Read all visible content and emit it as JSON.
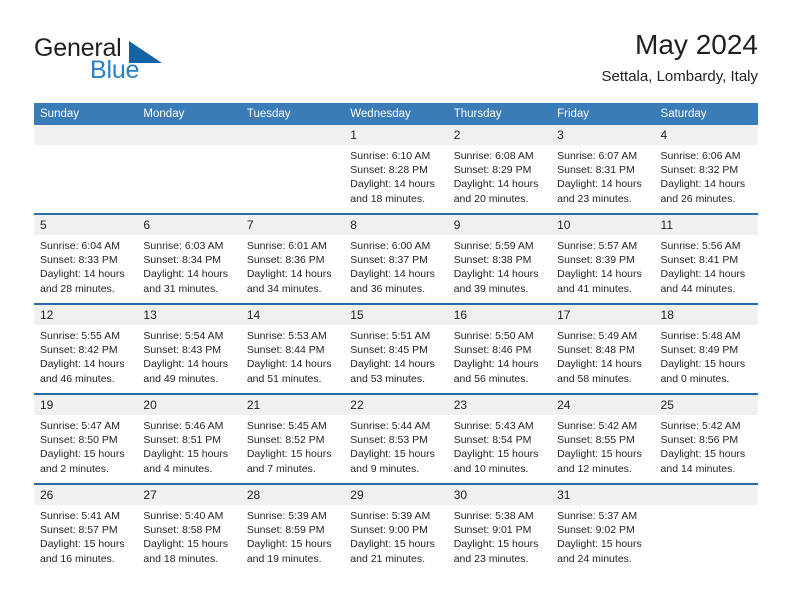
{
  "logo": {
    "word1": "General",
    "word2": "Blue",
    "triangle_color": "#1362a4",
    "blue_text_color": "#2980c4"
  },
  "header": {
    "title": "May 2024",
    "subtitle": "Settala, Lombardy, Italy"
  },
  "theme": {
    "header_blue": "#3a7cb8",
    "row_rule_blue": "#2b6ca8",
    "daynum_band": "#f0f0f0",
    "text": "#231f20"
  },
  "weekday_headers": [
    "Sunday",
    "Monday",
    "Tuesday",
    "Wednesday",
    "Thursday",
    "Friday",
    "Saturday"
  ],
  "labels": {
    "sunrise_prefix": "Sunrise:",
    "sunset_prefix": "Sunset:",
    "daylight_prefix": "Daylight:"
  },
  "weeks": [
    [
      {
        "day": "",
        "empty": true
      },
      {
        "day": "",
        "empty": true
      },
      {
        "day": "",
        "empty": true
      },
      {
        "day": "1",
        "sunrise": "Sunrise: 6:10 AM",
        "sunset": "Sunset: 8:28 PM",
        "daylight1": "Daylight: 14 hours",
        "daylight2": "and 18 minutes."
      },
      {
        "day": "2",
        "sunrise": "Sunrise: 6:08 AM",
        "sunset": "Sunset: 8:29 PM",
        "daylight1": "Daylight: 14 hours",
        "daylight2": "and 20 minutes."
      },
      {
        "day": "3",
        "sunrise": "Sunrise: 6:07 AM",
        "sunset": "Sunset: 8:31 PM",
        "daylight1": "Daylight: 14 hours",
        "daylight2": "and 23 minutes."
      },
      {
        "day": "4",
        "sunrise": "Sunrise: 6:06 AM",
        "sunset": "Sunset: 8:32 PM",
        "daylight1": "Daylight: 14 hours",
        "daylight2": "and 26 minutes."
      }
    ],
    [
      {
        "day": "5",
        "sunrise": "Sunrise: 6:04 AM",
        "sunset": "Sunset: 8:33 PM",
        "daylight1": "Daylight: 14 hours",
        "daylight2": "and 28 minutes."
      },
      {
        "day": "6",
        "sunrise": "Sunrise: 6:03 AM",
        "sunset": "Sunset: 8:34 PM",
        "daylight1": "Daylight: 14 hours",
        "daylight2": "and 31 minutes."
      },
      {
        "day": "7",
        "sunrise": "Sunrise: 6:01 AM",
        "sunset": "Sunset: 8:36 PM",
        "daylight1": "Daylight: 14 hours",
        "daylight2": "and 34 minutes."
      },
      {
        "day": "8",
        "sunrise": "Sunrise: 6:00 AM",
        "sunset": "Sunset: 8:37 PM",
        "daylight1": "Daylight: 14 hours",
        "daylight2": "and 36 minutes."
      },
      {
        "day": "9",
        "sunrise": "Sunrise: 5:59 AM",
        "sunset": "Sunset: 8:38 PM",
        "daylight1": "Daylight: 14 hours",
        "daylight2": "and 39 minutes."
      },
      {
        "day": "10",
        "sunrise": "Sunrise: 5:57 AM",
        "sunset": "Sunset: 8:39 PM",
        "daylight1": "Daylight: 14 hours",
        "daylight2": "and 41 minutes."
      },
      {
        "day": "11",
        "sunrise": "Sunrise: 5:56 AM",
        "sunset": "Sunset: 8:41 PM",
        "daylight1": "Daylight: 14 hours",
        "daylight2": "and 44 minutes."
      }
    ],
    [
      {
        "day": "12",
        "sunrise": "Sunrise: 5:55 AM",
        "sunset": "Sunset: 8:42 PM",
        "daylight1": "Daylight: 14 hours",
        "daylight2": "and 46 minutes."
      },
      {
        "day": "13",
        "sunrise": "Sunrise: 5:54 AM",
        "sunset": "Sunset: 8:43 PM",
        "daylight1": "Daylight: 14 hours",
        "daylight2": "and 49 minutes."
      },
      {
        "day": "14",
        "sunrise": "Sunrise: 5:53 AM",
        "sunset": "Sunset: 8:44 PM",
        "daylight1": "Daylight: 14 hours",
        "daylight2": "and 51 minutes."
      },
      {
        "day": "15",
        "sunrise": "Sunrise: 5:51 AM",
        "sunset": "Sunset: 8:45 PM",
        "daylight1": "Daylight: 14 hours",
        "daylight2": "and 53 minutes."
      },
      {
        "day": "16",
        "sunrise": "Sunrise: 5:50 AM",
        "sunset": "Sunset: 8:46 PM",
        "daylight1": "Daylight: 14 hours",
        "daylight2": "and 56 minutes."
      },
      {
        "day": "17",
        "sunrise": "Sunrise: 5:49 AM",
        "sunset": "Sunset: 8:48 PM",
        "daylight1": "Daylight: 14 hours",
        "daylight2": "and 58 minutes."
      },
      {
        "day": "18",
        "sunrise": "Sunrise: 5:48 AM",
        "sunset": "Sunset: 8:49 PM",
        "daylight1": "Daylight: 15 hours",
        "daylight2": "and 0 minutes."
      }
    ],
    [
      {
        "day": "19",
        "sunrise": "Sunrise: 5:47 AM",
        "sunset": "Sunset: 8:50 PM",
        "daylight1": "Daylight: 15 hours",
        "daylight2": "and 2 minutes."
      },
      {
        "day": "20",
        "sunrise": "Sunrise: 5:46 AM",
        "sunset": "Sunset: 8:51 PM",
        "daylight1": "Daylight: 15 hours",
        "daylight2": "and 4 minutes."
      },
      {
        "day": "21",
        "sunrise": "Sunrise: 5:45 AM",
        "sunset": "Sunset: 8:52 PM",
        "daylight1": "Daylight: 15 hours",
        "daylight2": "and 7 minutes."
      },
      {
        "day": "22",
        "sunrise": "Sunrise: 5:44 AM",
        "sunset": "Sunset: 8:53 PM",
        "daylight1": "Daylight: 15 hours",
        "daylight2": "and 9 minutes."
      },
      {
        "day": "23",
        "sunrise": "Sunrise: 5:43 AM",
        "sunset": "Sunset: 8:54 PM",
        "daylight1": "Daylight: 15 hours",
        "daylight2": "and 10 minutes."
      },
      {
        "day": "24",
        "sunrise": "Sunrise: 5:42 AM",
        "sunset": "Sunset: 8:55 PM",
        "daylight1": "Daylight: 15 hours",
        "daylight2": "and 12 minutes."
      },
      {
        "day": "25",
        "sunrise": "Sunrise: 5:42 AM",
        "sunset": "Sunset: 8:56 PM",
        "daylight1": "Daylight: 15 hours",
        "daylight2": "and 14 minutes."
      }
    ],
    [
      {
        "day": "26",
        "sunrise": "Sunrise: 5:41 AM",
        "sunset": "Sunset: 8:57 PM",
        "daylight1": "Daylight: 15 hours",
        "daylight2": "and 16 minutes."
      },
      {
        "day": "27",
        "sunrise": "Sunrise: 5:40 AM",
        "sunset": "Sunset: 8:58 PM",
        "daylight1": "Daylight: 15 hours",
        "daylight2": "and 18 minutes."
      },
      {
        "day": "28",
        "sunrise": "Sunrise: 5:39 AM",
        "sunset": "Sunset: 8:59 PM",
        "daylight1": "Daylight: 15 hours",
        "daylight2": "and 19 minutes."
      },
      {
        "day": "29",
        "sunrise": "Sunrise: 5:39 AM",
        "sunset": "Sunset: 9:00 PM",
        "daylight1": "Daylight: 15 hours",
        "daylight2": "and 21 minutes."
      },
      {
        "day": "30",
        "sunrise": "Sunrise: 5:38 AM",
        "sunset": "Sunset: 9:01 PM",
        "daylight1": "Daylight: 15 hours",
        "daylight2": "and 23 minutes."
      },
      {
        "day": "31",
        "sunrise": "Sunrise: 5:37 AM",
        "sunset": "Sunset: 9:02 PM",
        "daylight1": "Daylight: 15 hours",
        "daylight2": "and 24 minutes."
      },
      {
        "day": "",
        "empty": true
      }
    ]
  ]
}
